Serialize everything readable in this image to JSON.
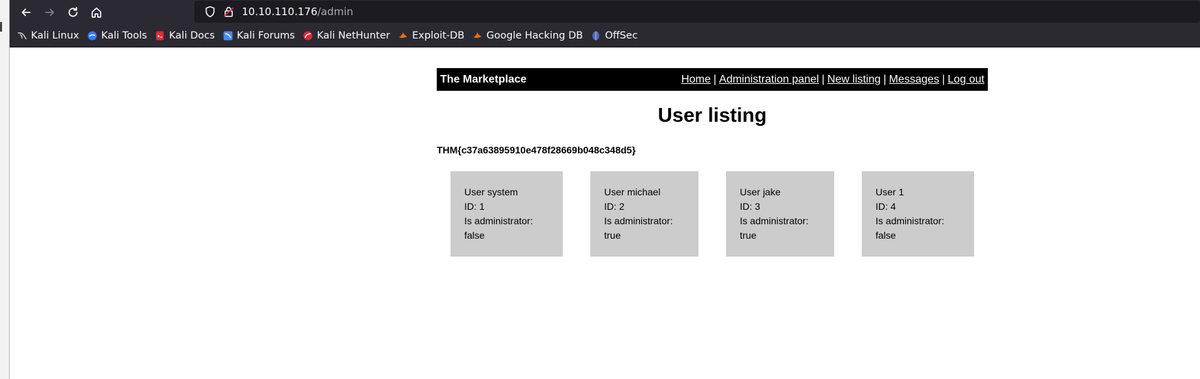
{
  "browser": {
    "url_host": "10.10.110.176",
    "url_path": "/admin",
    "bookmarks": [
      {
        "label": "Kali Linux",
        "icon": "kali-dragon-icon"
      },
      {
        "label": "Kali Tools",
        "icon": "kali-tools-icon"
      },
      {
        "label": "Kali Docs",
        "icon": "kali-docs-icon"
      },
      {
        "label": "Kali Forums",
        "icon": "kali-forums-icon"
      },
      {
        "label": "Kali NetHunter",
        "icon": "kali-nethunter-icon"
      },
      {
        "label": "Exploit-DB",
        "icon": "exploit-db-icon"
      },
      {
        "label": "Google Hacking DB",
        "icon": "ghdb-icon"
      },
      {
        "label": "OffSec",
        "icon": "offsec-icon"
      }
    ]
  },
  "site": {
    "title": "The Marketplace",
    "nav": [
      "Home",
      "Administration panel",
      "New listing",
      "Messages",
      "Log out"
    ]
  },
  "main": {
    "heading": "User listing",
    "flag": "THM{c37a63895910e478f28669b048c348d5}",
    "users": [
      {
        "name": "User system",
        "id": "ID: 1",
        "admin_label": "Is administrator:",
        "admin_value": "false"
      },
      {
        "name": "User michael",
        "id": "ID: 2",
        "admin_label": "Is administrator:",
        "admin_value": "true"
      },
      {
        "name": "User jake",
        "id": "ID: 3",
        "admin_label": "Is administrator:",
        "admin_value": "true"
      },
      {
        "name": "User 1",
        "id": "ID: 4",
        "admin_label": "Is administrator:",
        "admin_value": "false"
      }
    ]
  },
  "colors": {
    "chrome_bg": "#2b2a33",
    "urlbar_bg": "#1c1b22",
    "header_bg": "#000000",
    "card_bg": "#cccccc"
  }
}
